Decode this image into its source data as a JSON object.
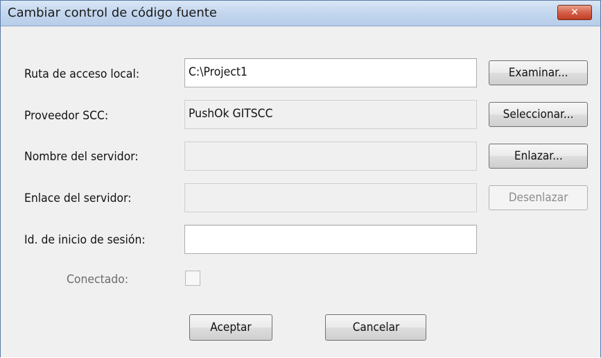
{
  "dialog": {
    "title": "Cambiar control de código fuente",
    "close_icon": "close-icon"
  },
  "fields": {
    "local_path": {
      "label": "Ruta de acceso local:",
      "value": "C:\\Project1"
    },
    "scc_provider": {
      "label": "Proveedor SCC:",
      "value": "PushOk GITSCC"
    },
    "server_name": {
      "label": "Nombre del servidor:",
      "value": ""
    },
    "server_link": {
      "label": "Enlace del servidor:",
      "value": ""
    },
    "login_id": {
      "label": "Id. de inicio de sesión:",
      "value": ""
    },
    "connected": {
      "label": "Conectado:",
      "checked": false
    }
  },
  "buttons": {
    "browse": "Examinar...",
    "select": "Seleccionar...",
    "bind": "Enlazar...",
    "unbind": "Desenlazar",
    "ok": "Aceptar",
    "cancel": "Cancelar"
  }
}
